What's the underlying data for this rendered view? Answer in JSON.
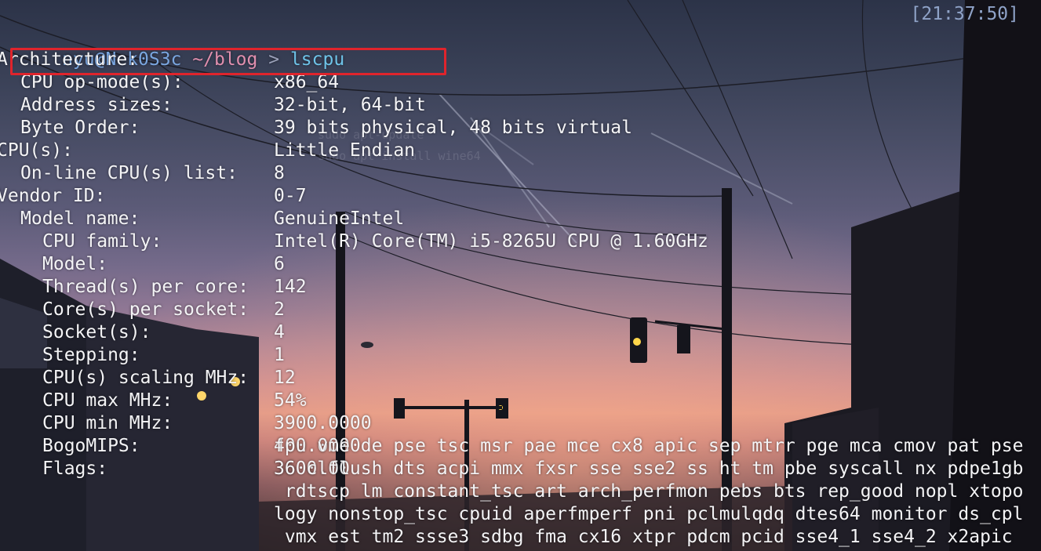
{
  "prompt": {
    "user_host": "nyu@Nek0S3c",
    "path": "~/blog",
    "separator": ">",
    "command": "lscpu"
  },
  "clock": "[21:37:50]",
  "highlighted_row": "CPU op-mode(s)",
  "rows": [
    {
      "key": "Architecture:",
      "value": "x86_64"
    },
    {
      "key": "CPU op-mode(s):",
      "value": "32-bit, 64-bit"
    },
    {
      "key": "Address sizes:",
      "value": "39 bits physical, 48 bits virtual"
    },
    {
      "key": "Byte Order:",
      "value": "Little Endian"
    },
    {
      "key": "CPU(s):",
      "value": "8"
    },
    {
      "key": "On-line CPU(s) list:",
      "value": "0-7"
    },
    {
      "key": "Vendor ID:",
      "value": "GenuineIntel"
    },
    {
      "key": "Model name:",
      "value": "Intel(R) Core(TM) i5-8265U CPU @ 1.60GHz"
    },
    {
      "key": "CPU family:",
      "value": "6"
    },
    {
      "key": "Model:",
      "value": "142"
    },
    {
      "key": "Thread(s) per core:",
      "value": "2"
    },
    {
      "key": "Core(s) per socket:",
      "value": "4"
    },
    {
      "key": "Socket(s):",
      "value": "1"
    },
    {
      "key": "Stepping:",
      "value": "12"
    },
    {
      "key": "CPU(s) scaling MHz:",
      "value": "54%"
    },
    {
      "key": "CPU max MHz:",
      "value": "3900.0000"
    },
    {
      "key": "CPU min MHz:",
      "value": "400.0000"
    },
    {
      "key": "BogoMIPS:",
      "value": "3600.00"
    },
    {
      "key": "Flags:",
      "value": ""
    }
  ],
  "flags_lines": [
    "fpu vme de pse tsc msr pae mce cx8 apic sep mtrr pge mca cmov pat pse",
    "36 clflush dts acpi mmx fxsr sse sse2 ss ht tm pbe syscall nx pdpe1gb",
    " rdtscp lm constant_tsc art arch_perfmon pebs bts rep_good nopl xtopo",
    "logy nonstop_tsc cpuid aperfmperf pni pclmulqdq dtes64 monitor ds_cpl",
    " vmx est tm2 ssse3 sdbg fma cx16 xtpr pdcm pcid sse4_1 sse4_2 x2apic"
  ],
  "colors": {
    "prompt_user": "#7aa6e0",
    "prompt_path": "#e08fae",
    "prompt_cmd": "#6ec3e8",
    "highlight_box": "#e0242c",
    "clock": "#8fa3c8"
  },
  "background": {
    "description_icon": "sunset-street-wallpaper-icon"
  }
}
